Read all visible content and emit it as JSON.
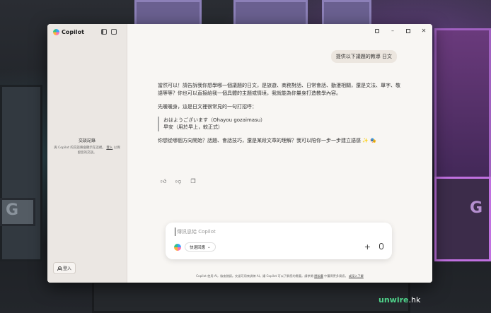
{
  "app": {
    "name": "Copilot"
  },
  "sidebar": {
    "history_title": "交談記錄",
    "history_text": "與 Copilot 的交談將會顯示在這裡。",
    "history_login": "登入",
    "history_tail": "以保留您的交談。",
    "login_label": "登入"
  },
  "chat": {
    "user_message": "提供以下議題的教導 日文",
    "reply_p1": "當然可以！請告訴我你想學哪一個議題的日文，是旅遊、商務對話、日常會話、動漫相關，還是文法、單字、敬語等等？你也可以直接給我一個具體的主題或情境，我就能為你量身打造教學內容。",
    "reply_p2": "先暖暖身，這是日文裡很常見的一句打招呼：",
    "quote_line1": "おはようございます（Ohayou gozaimasu）",
    "quote_line2": "早安（用於早上，較正式）",
    "reply_p3": "你想從哪個方向開始？話題、會話技巧，還是某段文章的理解？我可以陪你一步一步建立語感 ✨ 🎭"
  },
  "composer": {
    "placeholder": "傳訊息給 Copilot",
    "quick_reply_label": "快速回應"
  },
  "footer": {
    "text": "Copilot 使用 AI，檢查錯誤。交談可用來訓練 AI。讓 Copilot 可以了解您的需要。請參閱",
    "link1": "隱私權",
    "mid": "中獲得更多資訊。",
    "link2": "或深入了解"
  },
  "watermark": {
    "brand": "unwire",
    "tld": ".hk"
  },
  "icons": {
    "logo": "copilot-logo-icon",
    "sidebar_toggle": "sidebar-toggle-icon",
    "new_chat": "new-chat-icon",
    "thumbs_up": "thumbs-up-icon",
    "thumbs_down": "thumbs-down-icon",
    "copy": "copy-icon",
    "plus": "plus-icon",
    "mic": "microphone-icon"
  }
}
